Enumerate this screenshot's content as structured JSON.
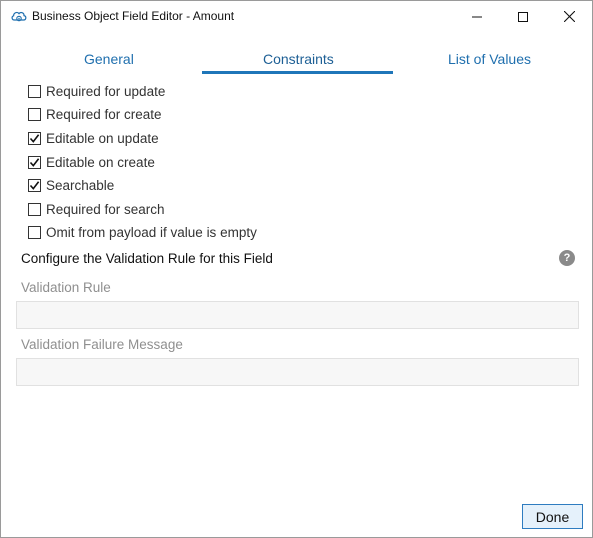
{
  "window": {
    "title": "Business Object Field Editor - Amount"
  },
  "tabs": [
    {
      "label": "General",
      "selected": false
    },
    {
      "label": "Constraints",
      "selected": true
    },
    {
      "label": "List of Values",
      "selected": false
    }
  ],
  "constraints": [
    {
      "label": "Required for update",
      "checked": false
    },
    {
      "label": "Required for create",
      "checked": false
    },
    {
      "label": "Editable on update",
      "checked": true
    },
    {
      "label": "Editable on create",
      "checked": true
    },
    {
      "label": "Searchable",
      "checked": true
    },
    {
      "label": "Required for search",
      "checked": false
    },
    {
      "label": "Omit from payload if value is empty",
      "checked": false
    }
  ],
  "validation": {
    "section_title": "Configure the Validation Rule for this Field",
    "help_icon": "?",
    "rule_label": "Validation Rule",
    "rule_value": "",
    "message_label": "Validation Failure Message",
    "message_value": ""
  },
  "footer": {
    "done_label": "Done"
  },
  "colors": {
    "accent": "#1f76b9",
    "tab_text": "#1f6fae",
    "disabled_label": "#8f8f8f"
  }
}
